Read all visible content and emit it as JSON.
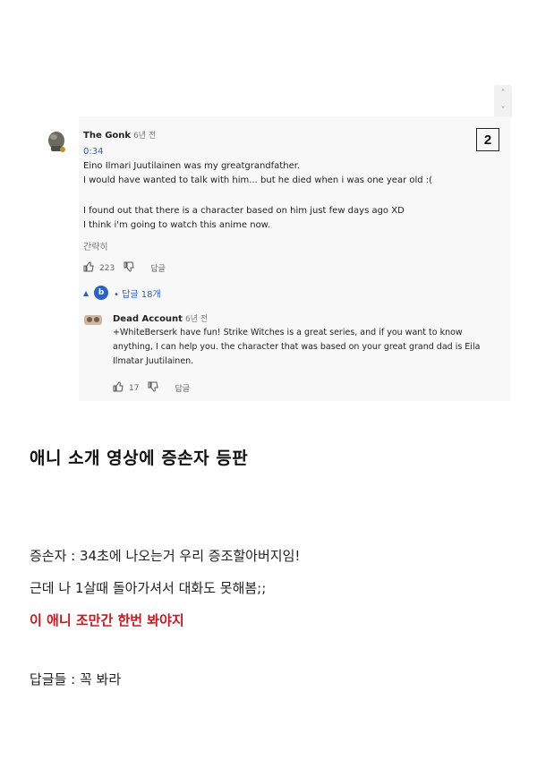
{
  "comment": {
    "author": "The Gonk",
    "time_ago": "6년 전",
    "timestamp": "0:34",
    "lines": [
      "Eino Ilmari Juutilainen was my greatgrandfather.",
      "I would have wanted to talk with him... but he died when i was one year old :(",
      "",
      "I found out that there is a character based on him just few days ago XD",
      "I think i'm going to watch this anime now."
    ],
    "collapse_label": "간략히",
    "likes": "223",
    "reply_label": "답글",
    "replies_avatar_letter": "b",
    "replies_toggle": "• 답글 18개"
  },
  "reply": {
    "author": "Dead Account",
    "time_ago": "6년 전",
    "lines": [
      "+WhiteBerserk have fun! Strike Witches is a great series, and if you want to know",
      "anything, I can help you. the character that was based on your great grand dad is Eila",
      "Ilmatar Juutilainen."
    ],
    "likes": "17",
    "reply_label": "답글"
  },
  "badge_number": "2",
  "heading": "애니 소개 영상에 증손자 등판",
  "paragraphs": {
    "line1": "증손자 : 34초에 나오는거 우리 증조할아버지임!",
    "line2": "근데 나 1살때 돌아가셔서 대화도 못해봄;;",
    "line3_red": "이 애니 조만간 한번 봐야지",
    "line4": "답글들 : 꼭 봐라"
  },
  "colors": {
    "link_blue": "#2a62c9",
    "emphasis_red": "#d3141b",
    "panel_bg": "#f8f8f8"
  },
  "icons": [
    "thumbs-up-icon",
    "thumbs-down-icon",
    "chevron-up-icon",
    "chevron-down-icon",
    "caret-up-icon"
  ]
}
